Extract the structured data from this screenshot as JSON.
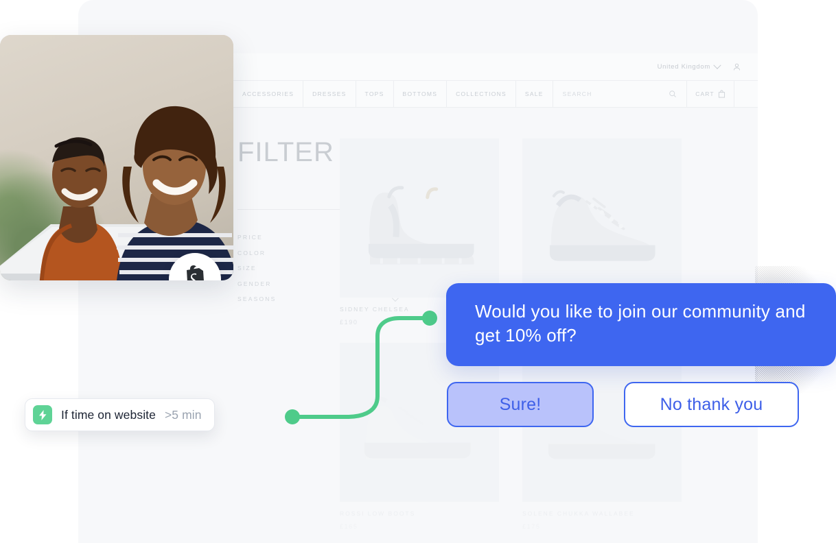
{
  "store": {
    "topbar": {
      "locale_label": "United Kingdom",
      "locale_chevron_icon": "chevron-down-icon",
      "account_icon": "user-icon"
    },
    "nav_items": [
      {
        "label": "ACCESSORIES"
      },
      {
        "label": "DRESSES"
      },
      {
        "label": "TOPS"
      },
      {
        "label": "BOTTOMS"
      },
      {
        "label": "COLLECTIONS"
      },
      {
        "label": "SALE"
      }
    ],
    "search": {
      "placeholder": "SEARCH",
      "icon": "search-icon"
    },
    "cart": {
      "label": "CART",
      "icon": "shopping-bag-icon"
    },
    "page_title": "FILTER",
    "filters": [
      {
        "label": "PRICE",
        "chevron_icon": "chevron-down-icon"
      },
      {
        "label": "COLOR",
        "chevron_icon": "chevron-down-icon"
      },
      {
        "label": "SIZE",
        "chevron_icon": "chevron-down-icon"
      },
      {
        "label": "GENDER",
        "chevron_icon": "chevron-down-icon"
      },
      {
        "label": "SEASONS",
        "chevron_icon": "chevron-down-icon"
      }
    ],
    "products": [
      {
        "name": "SIDNEY CHELSEA",
        "price": "£190",
        "image": "chelsea-boot"
      },
      {
        "name": "",
        "price": "",
        "image": "hiking-boot"
      },
      {
        "name": "ROSSI LOW BOOTS",
        "price": "£165",
        "image": "low-sneaker"
      },
      {
        "name": "SOLENE CHUKKA WALLABEE",
        "price": "£175",
        "image": "chukka-boot"
      }
    ]
  },
  "photo_card": {
    "shopify_badge_icon": "shopify-bag-icon",
    "alt": "two people smiling at a laptop"
  },
  "automation": {
    "trigger": {
      "icon": "lightning-bolt-icon",
      "label": "If time on website",
      "value": ">5 min"
    },
    "connector": {
      "icon": "flow-connector-line",
      "color": "#4ecb8a"
    }
  },
  "chat": {
    "message": "Would you like to join our community and get 10% off?",
    "replies": [
      {
        "label": "Sure!",
        "style": "filled"
      },
      {
        "label": "No thank you",
        "style": "outline"
      }
    ],
    "accent_color": "#3e66f0",
    "reply_fill_color": "#b9c2fb"
  }
}
